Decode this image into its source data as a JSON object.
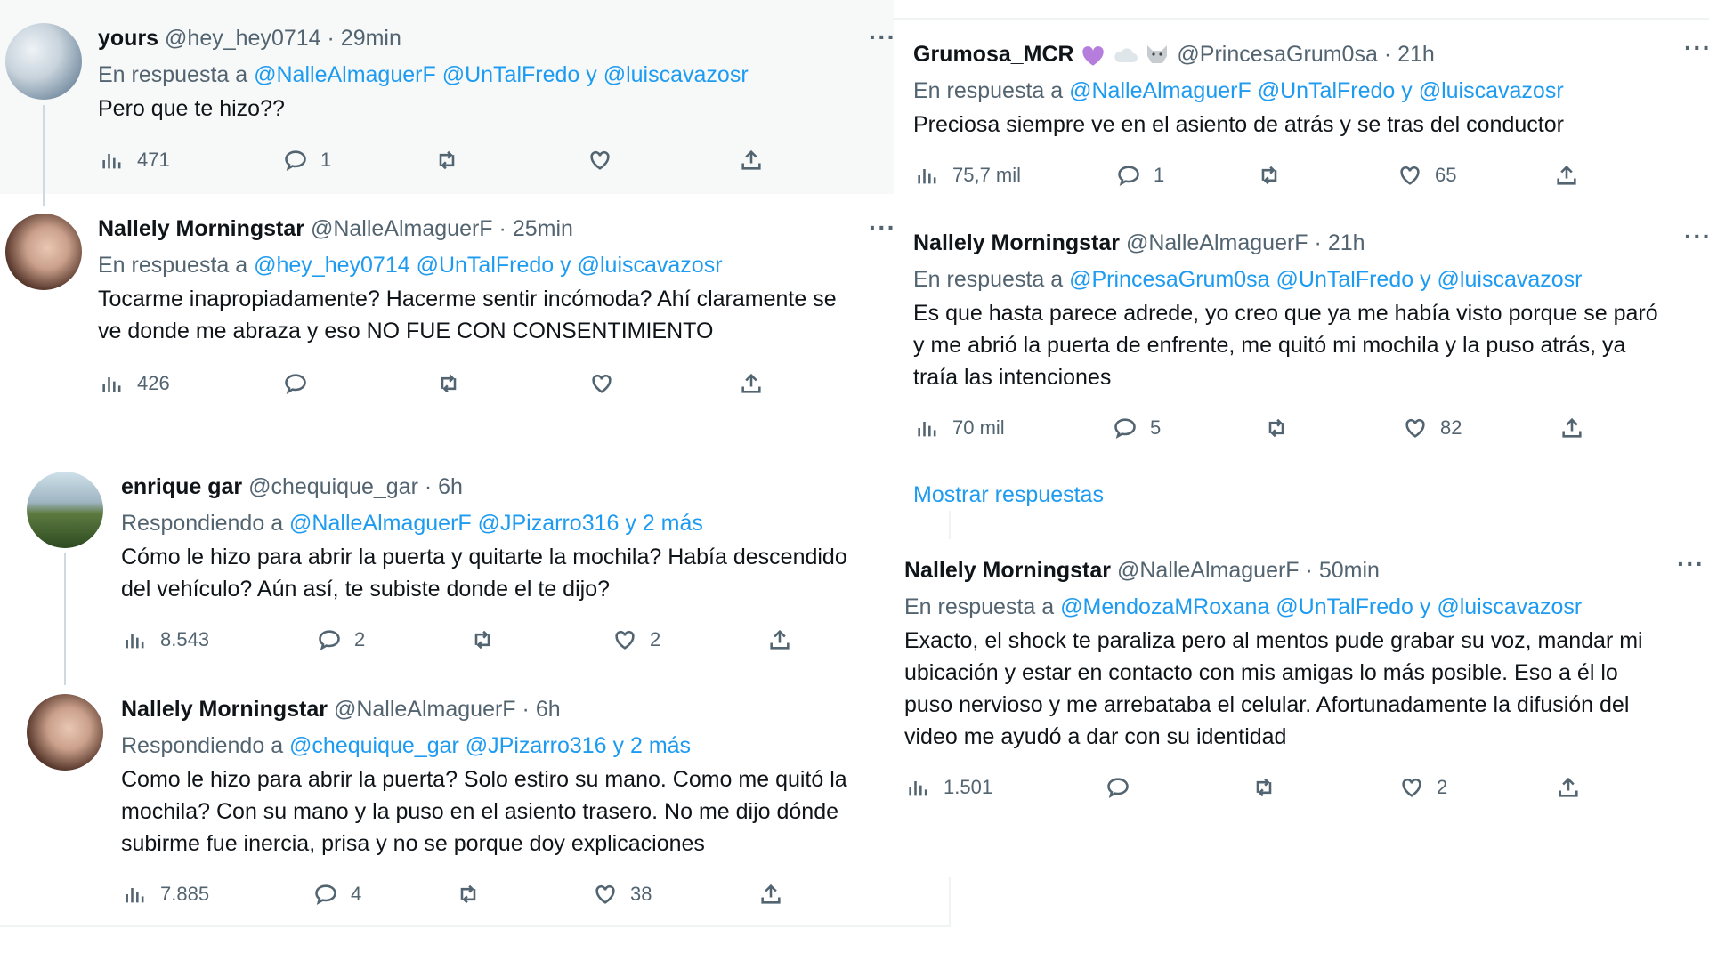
{
  "left_top_tweet": {
    "name": "yours",
    "handle": "@hey_hey0714",
    "time": "29min",
    "reply_prefix": "En respuesta a",
    "reply_users": [
      "@NalleAlmaguerF",
      "@UnTalFredo",
      "y",
      "@luiscavazosr"
    ],
    "text": "Pero que te hizo??",
    "views": "471",
    "replies": "1",
    "retweets": "",
    "likes": ""
  },
  "left_mid_tweet": {
    "name": "Nallely Morningstar",
    "handle": "@NalleAlmaguerF",
    "time": "25min",
    "reply_prefix": "En respuesta a",
    "reply_users": [
      "@hey_hey0714",
      "@UnTalFredo",
      "y",
      "@luiscavazosr"
    ],
    "text_lines": [
      "Tocarme inapropiadamente? Hacerme sentir incómoda? Ahí claramente se",
      "ve donde me abraza y eso NO FUE CON CONSENTIMIENTO"
    ],
    "views": "426",
    "replies": "",
    "retweets": "",
    "likes": ""
  },
  "left_bot_tweet1": {
    "name": "enrique gar",
    "handle": "@chequique_gar",
    "time": "6h",
    "reply_prefix": "Respondiendo a",
    "reply_users": [
      "@NalleAlmaguerF",
      "@JPizarro316",
      "y 2 más"
    ],
    "text_lines": [
      "Cómo le hizo para abrir la puerta y quitarte la mochila? Había descendido",
      "del vehículo? Aún así, te subiste donde el te dijo?"
    ],
    "views": "8.543",
    "replies": "2",
    "retweets": "",
    "likes": "2"
  },
  "left_bot_tweet2": {
    "name": "Nallely Morningstar",
    "handle": "@NalleAlmaguerF",
    "time": "6h",
    "reply_prefix": "Respondiendo a",
    "reply_users": [
      "@chequique_gar",
      "@JPizarro316",
      "y 2 más"
    ],
    "text_lines": [
      "Como le hizo para abrir la puerta? Solo estiro su mano. Como me quitó la",
      "mochila? Con su mano y la puso en el asiento trasero. No me dijo dónde",
      "subirme fue inercia, prisa y no se porque doy explicaciones"
    ],
    "views": "7.885",
    "replies": "4",
    "retweets": "",
    "likes": "38"
  },
  "right_top_tweet1": {
    "name": "Grumosa_MCR",
    "handle": "@PrincesaGrum0sa",
    "time": "21h",
    "reply_prefix": "En respuesta a",
    "reply_users": [
      "@NalleAlmaguerF",
      "@UnTalFredo",
      "y",
      "@luiscavazosr"
    ],
    "text": "Preciosa siempre ve en el asiento de atrás y se tras del conductor",
    "views": "75,7 mil",
    "replies": "1",
    "retweets": "",
    "likes": "65"
  },
  "right_top_tweet2": {
    "name": "Nallely Morningstar",
    "handle": "@NalleAlmaguerF",
    "time": "21h",
    "reply_prefix": "En respuesta a",
    "reply_users": [
      "@PrincesaGrum0sa",
      "@UnTalFredo",
      "y",
      "@luiscavazosr"
    ],
    "text_lines": [
      "Es que hasta parece adrede, yo creo que ya me había visto porque se paró",
      "y me abrió la puerta de enfrente, me quitó mi mochila y la puso atrás, ya",
      "traía las intenciones"
    ],
    "views": "70 mil",
    "replies": "5",
    "retweets": "",
    "likes": "82"
  },
  "show_replies": "Mostrar respuestas",
  "right_bot_tweet": {
    "name": "Nallely Morningstar",
    "handle": "@NalleAlmaguerF",
    "time": "50min",
    "reply_prefix": "En respuesta a",
    "reply_users": [
      "@MendozaMRoxana",
      "@UnTalFredo",
      "y",
      "@luiscavazosr"
    ],
    "text_lines": [
      "Exacto, el shock te paraliza pero al mentos pude grabar su voz, mandar mi",
      "ubicación y estar en contacto con mis amigas lo más posible. Eso a él lo",
      "puso nervioso y me arrebataba el celular. Afortunadamente la difusión del",
      "video me ayudó a dar con su identidad"
    ],
    "views": "1.501",
    "replies": "",
    "retweets": "",
    "likes": "2"
  },
  "common": {
    "dot": "·",
    "more": "···"
  },
  "colors": {
    "link": "#1d9bf0",
    "muted": "#536471",
    "text": "#0f1419",
    "highlight_bg": "#f7f9f9"
  },
  "icons": [
    "views-icon",
    "reply-icon",
    "retweet-icon",
    "like-icon",
    "share-icon",
    "more-icon",
    "purple-heart-icon",
    "cloud-icon",
    "wolf-icon"
  ]
}
